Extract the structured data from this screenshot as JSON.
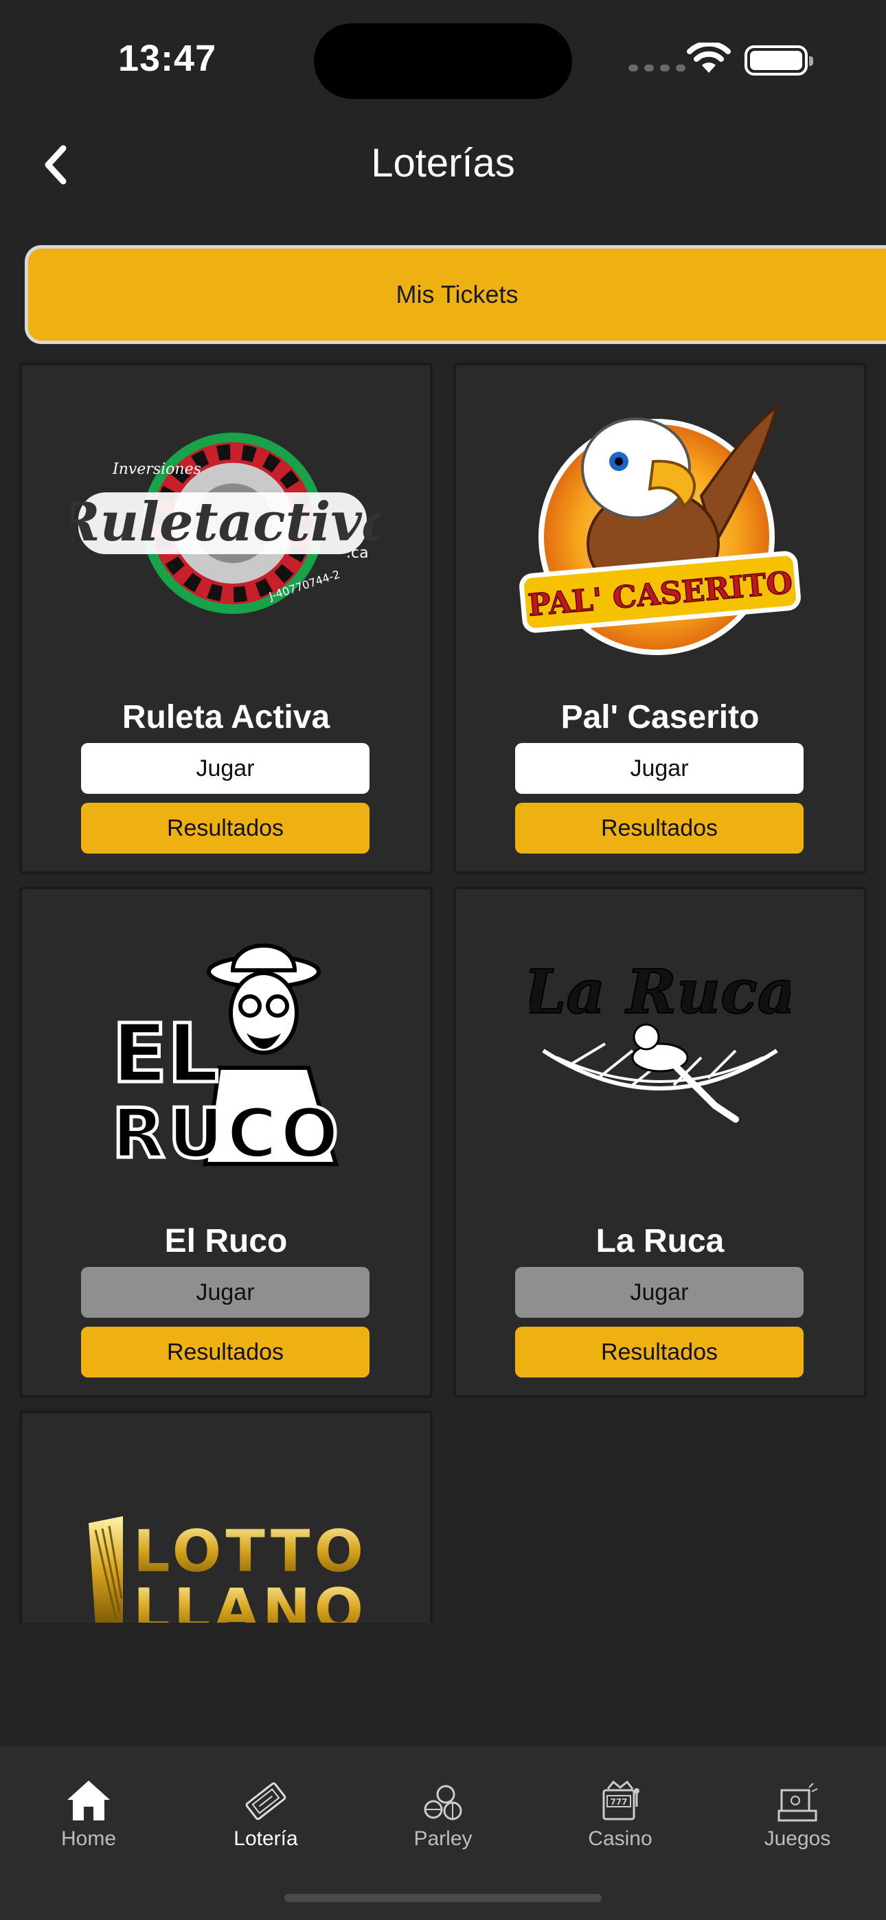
{
  "status": {
    "time": "13:47"
  },
  "header": {
    "title": "Loterías"
  },
  "tickets_button": "Mis Tickets",
  "cards": [
    {
      "name": "Ruleta Activa",
      "logo_text": "Ruletactiva",
      "logo_small": "Inversiones",
      "logo_suffix": ".ca",
      "logo_rif": "J-40770744-2",
      "play_label": "Jugar",
      "results_label": "Resultados",
      "play_enabled": true
    },
    {
      "name": "Pal' Caserito",
      "logo_text": "PAL' CASERITO",
      "play_label": "Jugar",
      "results_label": "Resultados",
      "play_enabled": true
    },
    {
      "name": "El Ruco",
      "logo_text_1": "EL",
      "logo_text_2": "RUCO",
      "play_label": "Jugar",
      "results_label": "Resultados",
      "play_enabled": false
    },
    {
      "name": "La Ruca",
      "logo_text": "La Ruca",
      "play_label": "Jugar",
      "results_label": "Resultados",
      "play_enabled": false
    },
    {
      "logo_text_1": "LOTTO",
      "logo_text_2": "LLANO"
    }
  ],
  "tabs": [
    {
      "label": "Home",
      "icon": "home-icon",
      "active": false
    },
    {
      "label": "Lotería",
      "icon": "lottery-ticket-icon",
      "active": true
    },
    {
      "label": "Parley",
      "icon": "sports-balls-icon",
      "active": false
    },
    {
      "label": "Casino",
      "icon": "slot-machine-icon",
      "active": false
    },
    {
      "label": "Juegos",
      "icon": "arcade-icon",
      "active": false
    }
  ],
  "colors": {
    "background": "#242424",
    "accent": "#eeb111",
    "card": "#2a2a2a",
    "disabled": "#8f8f8f"
  }
}
